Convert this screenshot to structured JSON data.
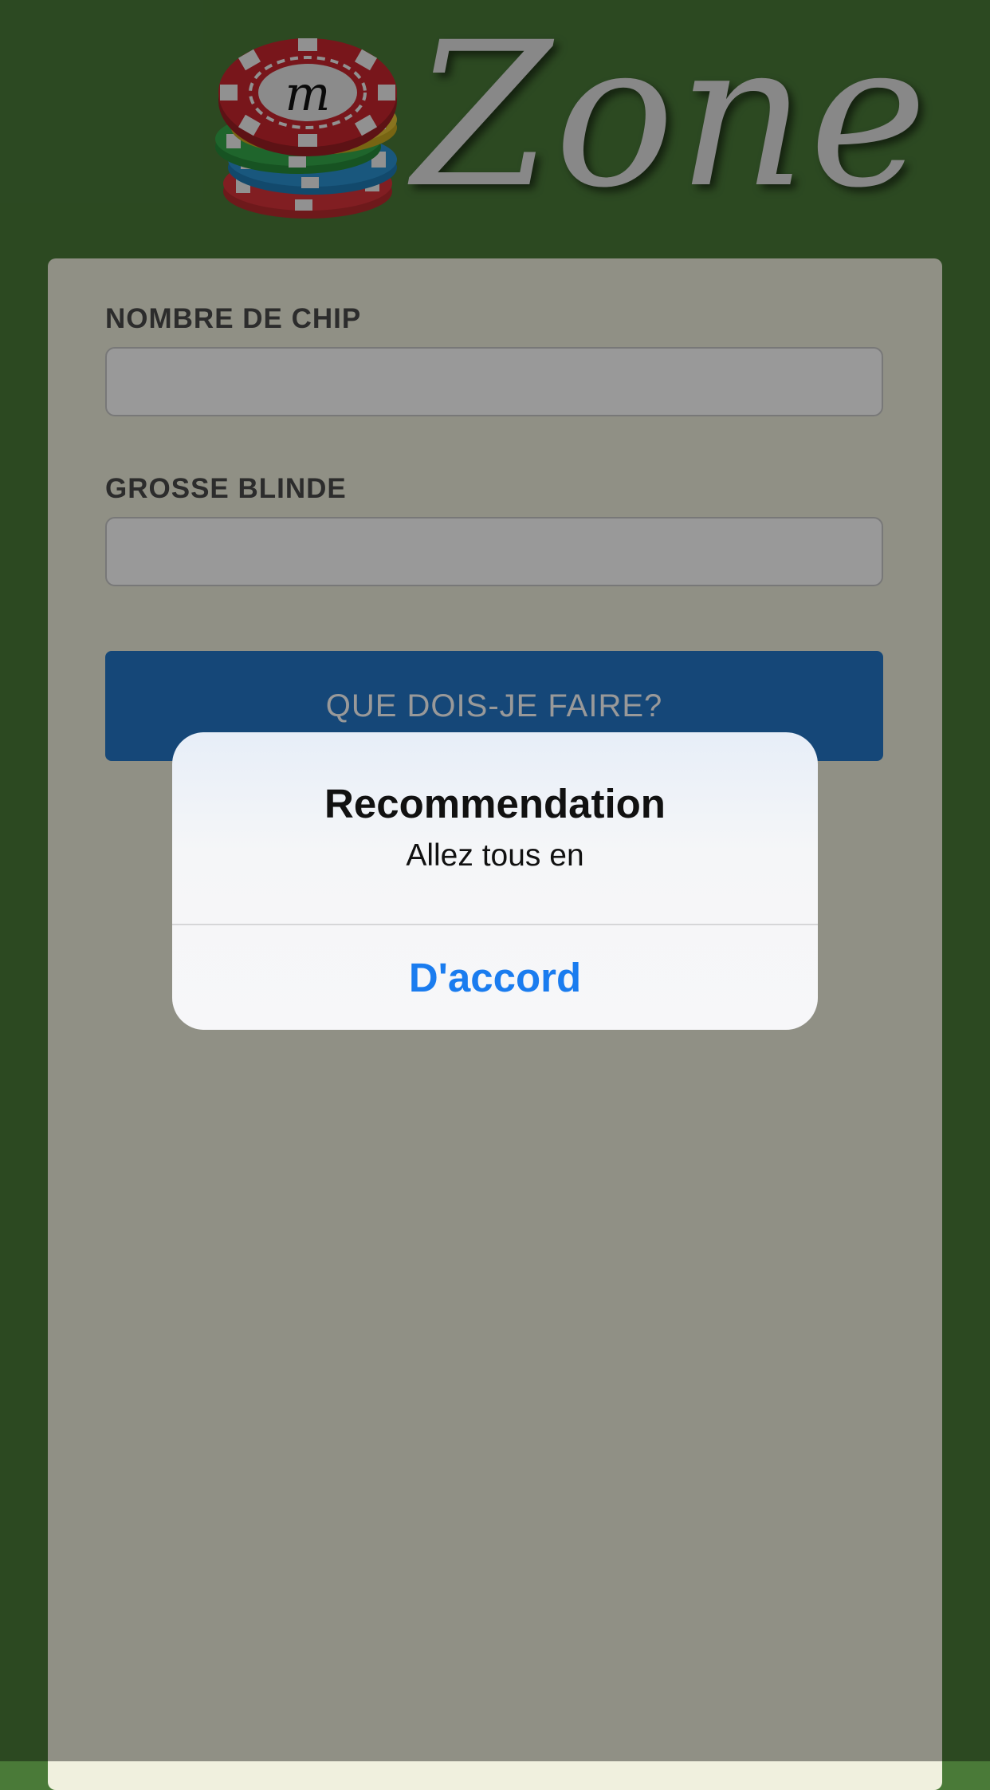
{
  "header": {
    "logo_letter": "m",
    "logo_text": "Zone"
  },
  "form": {
    "chips_label": "NOMBRE DE CHIP",
    "chips_value": "",
    "blind_label": "GROSSE BLINDE",
    "blind_value": "",
    "submit_label": "QUE DOIS-JE FAIRE?"
  },
  "alert": {
    "title": "Recommendation",
    "message": "Allez tous en",
    "button_label": "D'accord"
  },
  "colors": {
    "background": "#4a7a38",
    "card": "#f0f0de",
    "primary_button": "#2477c8",
    "alert_action": "#1a7cef"
  },
  "icons": {
    "logo": "poker-chip-stack-icon"
  }
}
